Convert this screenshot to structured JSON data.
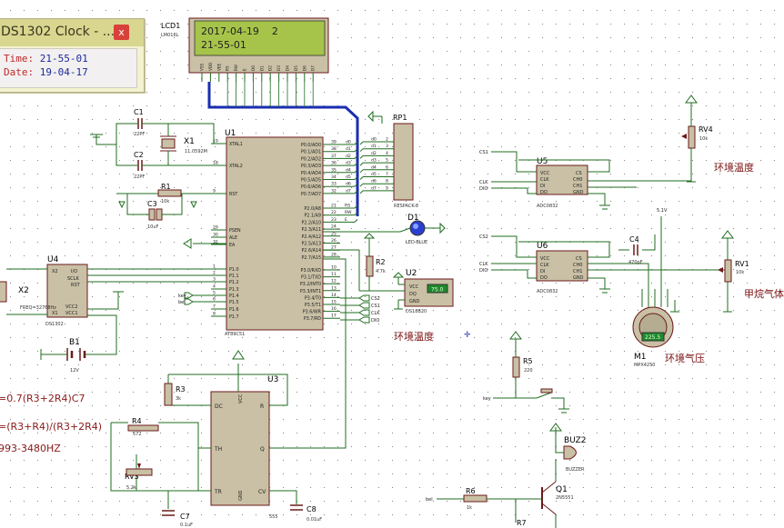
{
  "sim_window": {
    "title": "DS1302 Clock - ...",
    "close_glyph": "x",
    "time_label": "Time:",
    "time_value": "21-55-01",
    "date_label": "Date:",
    "date_value": "19-04-17"
  },
  "lcd": {
    "ref": "LCD1",
    "model": "LM016L",
    "line1": "2017-04-19    2",
    "line2": "21-55-01",
    "pins": [
      "VSS",
      "VDD",
      "VEE",
      "RS",
      "RW",
      "E",
      "D0",
      "D1",
      "D2",
      "D3",
      "D4",
      "D5",
      "D6",
      "D7"
    ]
  },
  "mcu": {
    "ref": "U1",
    "model": "AT89C51",
    "left_pins": [
      {
        "num": "19",
        "name": "XTAL1"
      },
      {
        "num": "18",
        "name": "XTAL2"
      },
      {
        "num": "9",
        "name": "RST"
      },
      {
        "num": "29",
        "name": "PSEN"
      },
      {
        "num": "30",
        "name": "ALE"
      },
      {
        "num": "31",
        "name": "EA"
      },
      {
        "num": "1",
        "name": "P1.0"
      },
      {
        "num": "2",
        "name": "P1.1"
      },
      {
        "num": "3",
        "name": "P1.2"
      },
      {
        "num": "4",
        "name": "P1.3"
      },
      {
        "num": "5",
        "name": "P1.4"
      },
      {
        "num": "6",
        "name": "P1.5"
      },
      {
        "num": "7",
        "name": "P1.6"
      },
      {
        "num": "8",
        "name": "P1.7"
      }
    ],
    "right_pins": [
      {
        "num": "39",
        "name": "P0.0/AD0"
      },
      {
        "num": "38",
        "name": "P0.1/AD1"
      },
      {
        "num": "37",
        "name": "P0.2/AD2"
      },
      {
        "num": "36",
        "name": "P0.3/AD3"
      },
      {
        "num": "35",
        "name": "P0.4/AD4"
      },
      {
        "num": "34",
        "name": "P0.5/AD5"
      },
      {
        "num": "33",
        "name": "P0.6/AD6"
      },
      {
        "num": "32",
        "name": "P0.7/AD7"
      },
      {
        "num": "21",
        "name": "P2.0/A8"
      },
      {
        "num": "22",
        "name": "P2.1/A9"
      },
      {
        "num": "23",
        "name": "P2.2/A10"
      },
      {
        "num": "24",
        "name": "P2.3/A11"
      },
      {
        "num": "25",
        "name": "P2.4/A12"
      },
      {
        "num": "26",
        "name": "P2.5/A13"
      },
      {
        "num": "27",
        "name": "P2.6/A14"
      },
      {
        "num": "28",
        "name": "P2.7/A15"
      },
      {
        "num": "10",
        "name": "P3.0/RXD"
      },
      {
        "num": "11",
        "name": "P3.1/TXD"
      },
      {
        "num": "12",
        "name": "P3.2/INT0"
      },
      {
        "num": "13",
        "name": "P3.3/INT1"
      },
      {
        "num": "14",
        "name": "P3.4/T0"
      },
      {
        "num": "15",
        "name": "P3.5/T1"
      },
      {
        "num": "16",
        "name": "P3.6/WR"
      },
      {
        "num": "17",
        "name": "P3.7/RD"
      }
    ],
    "bus_labels": [
      "d0",
      "d1",
      "d2",
      "d3",
      "d4",
      "d5",
      "d6",
      "d7"
    ],
    "ctrl_labels": [
      "RS",
      "RW",
      "E"
    ],
    "p3_net_labels": [
      "CS2",
      "CS1",
      "CLK",
      "DIO"
    ],
    "p1_net_labels": [
      "key",
      "bel"
    ]
  },
  "rp1": {
    "ref": "RP1",
    "model": "RESPACK-8"
  },
  "d1": {
    "ref": "D1",
    "model": "LED-BLUE"
  },
  "r2": {
    "ref": "R2",
    "value": "4.7k"
  },
  "u2": {
    "ref": "U2",
    "model": "DS18B20",
    "display": "75.0",
    "pins": [
      "VCC",
      "DQ",
      "GND"
    ]
  },
  "label_env_temp_left": "环境温度",
  "label_env_temp_right": "环境温度",
  "label_methane": "甲烷气体",
  "label_env_pressure": "环境气压",
  "c1": {
    "ref": "C1",
    "value": "22PF"
  },
  "c2": {
    "ref": "C2",
    "value": "22PF"
  },
  "x1": {
    "ref": "X1",
    "value": "11.0592M"
  },
  "r1": {
    "ref": "R1",
    "value": "10k"
  },
  "c3": {
    "ref": "C3",
    "value": "10uF"
  },
  "u4": {
    "ref": "U4",
    "model": "DS1302",
    "pins_left": [
      "X2",
      "",
      "X1"
    ],
    "pins_right": [
      "I/O",
      "SCLK",
      "RST",
      "VCC2",
      "VCC1"
    ]
  },
  "x2": {
    "ref": "X2",
    "value": "FREQ=32768Hz"
  },
  "b1": {
    "ref": "B1",
    "value": "12V"
  },
  "u5": {
    "ref": "U5",
    "model": "ADC0832",
    "pins_left": [
      "VCC",
      "CLK",
      "DI",
      "DO"
    ],
    "pins_right": [
      "CS",
      "CH0",
      "CH1",
      "GND"
    ]
  },
  "u6": {
    "ref": "U6",
    "model": "ADC0832",
    "pins_left": [
      "VCC",
      "CLK",
      "DI",
      "DO"
    ],
    "pins_right": [
      "CS",
      "CH0",
      "CH1",
      "GND"
    ]
  },
  "u5_nets": [
    "CS1",
    "CLK",
    "DIO"
  ],
  "u6_nets": [
    "CS2",
    "CLK",
    "DIO"
  ],
  "rv4": {
    "ref": "RV4",
    "value": "10k"
  },
  "rv1": {
    "ref": "RV1",
    "value": "10k"
  },
  "c4": {
    "ref": "C4",
    "value": "470pF"
  },
  "v51": "5.1V",
  "m1": {
    "ref": "M1",
    "model": "MPX4250",
    "display": "225.5"
  },
  "r5": {
    "ref": "R5",
    "value": "220"
  },
  "key_net": "key",
  "bel_net": "bel",
  "buz2": {
    "ref": "BUZ2",
    "model": "BUZZER"
  },
  "q1": {
    "ref": "Q1",
    "model": "2N5551"
  },
  "r6": {
    "ref": "R6",
    "value": "1k"
  },
  "r7": {
    "ref": "R7"
  },
  "u3": {
    "ref": "U3",
    "model": "555",
    "pins_left": [
      "DC",
      "TH",
      "TR"
    ],
    "pins_right": [
      "R",
      "Q",
      "CV"
    ],
    "top": "VCC",
    "bottom": "GND"
  },
  "r3": {
    "ref": "R3",
    "value": "3k"
  },
  "r4": {
    "ref": "R4",
    "value": "572"
  },
  "rv3": {
    "ref": "RV3",
    "value": "5.2k"
  },
  "c7": {
    "ref": "C7",
    "value": "0.1uF"
  },
  "c8": {
    "ref": "C8",
    "value": "0.01uF"
  },
  "formula1": "=0.7(R3+2R4)C7",
  "formula2": "=(R3+R4)/(R3+2R4)",
  "formula3": "993-3480HZ",
  "colors": {
    "wire": "#1f6d1f",
    "component": "#7e1a1a",
    "body": "#c8bfa6",
    "bus": "#1b2db1",
    "lcd_screen": "#a6c44a",
    "formula": "#8a1a1a",
    "label_text": "#7a1010"
  }
}
